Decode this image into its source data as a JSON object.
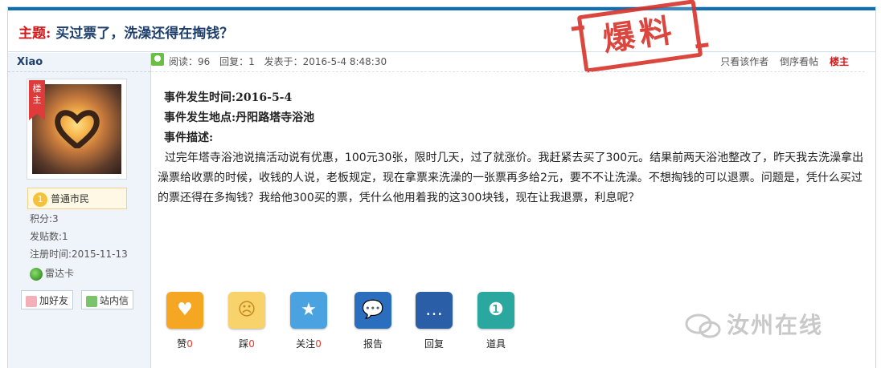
{
  "thread": {
    "title_prefix": "主题:",
    "title": "买过票了，洗澡还得在掏钱？",
    "stamp": "爆料"
  },
  "author": {
    "name": "Xiao",
    "ribbon": "楼主",
    "rank": "普通市民",
    "rank_level": "1",
    "points": "积分:3",
    "posts": "发贴数:1",
    "registered": "注册时间:2015-11-13",
    "badge": "雷达卡",
    "add_friend": "加好友",
    "message": "站内信"
  },
  "meta": {
    "views": "阅读：96",
    "replies": "回复：1",
    "posted": "发表于：2016-5-4 8:48:30",
    "only_author": "只看该作者",
    "reverse": "倒序看帖",
    "floor": "楼主"
  },
  "post": {
    "time_label": "事件发生时间:2016-5-4",
    "place_label": "事件发生地点:丹阳路塔寺浴池",
    "desc_label": "事件描述:",
    "body": "  过完年塔寺浴池说搞活动说有优惠，100元30张，限时几天，过了就涨价。我赶紧去买了300元。结果前两天浴池整改了，昨天我去洗澡拿出澡票给收票的时候，收钱的人说，老板规定，现在拿票来洗澡的一张票再多给2元，要不不让洗澡。不想掏钱的可以退票。问题是，凭什么买过的票还得在多掏钱？我给他300买的票，凭什么他用着我的这300块钱，现在让我退票，利息呢？"
  },
  "actions": [
    {
      "label": "赞",
      "count": "0",
      "icon": "heart-icon",
      "color": "#f5a623"
    },
    {
      "label": "踩",
      "count": "0",
      "icon": "sad-face-icon",
      "color": "#f8d26a"
    },
    {
      "label": "关注",
      "count": "0",
      "icon": "star-icon",
      "color": "#4aa3e0"
    },
    {
      "label": "报告",
      "count": "",
      "icon": "chat-bubbles-icon",
      "color": "#2a6ebd"
    },
    {
      "label": "回复",
      "count": "",
      "icon": "reply-bubble-icon",
      "color": "#2a5ea6"
    },
    {
      "label": "道具",
      "count": "",
      "icon": "medal-icon",
      "color": "#2aa8a0"
    }
  ],
  "watermark": "汝州在线",
  "colors": {
    "accent": "#0f6fb3",
    "title": "#1f3f6b",
    "red": "#d21a1a"
  }
}
